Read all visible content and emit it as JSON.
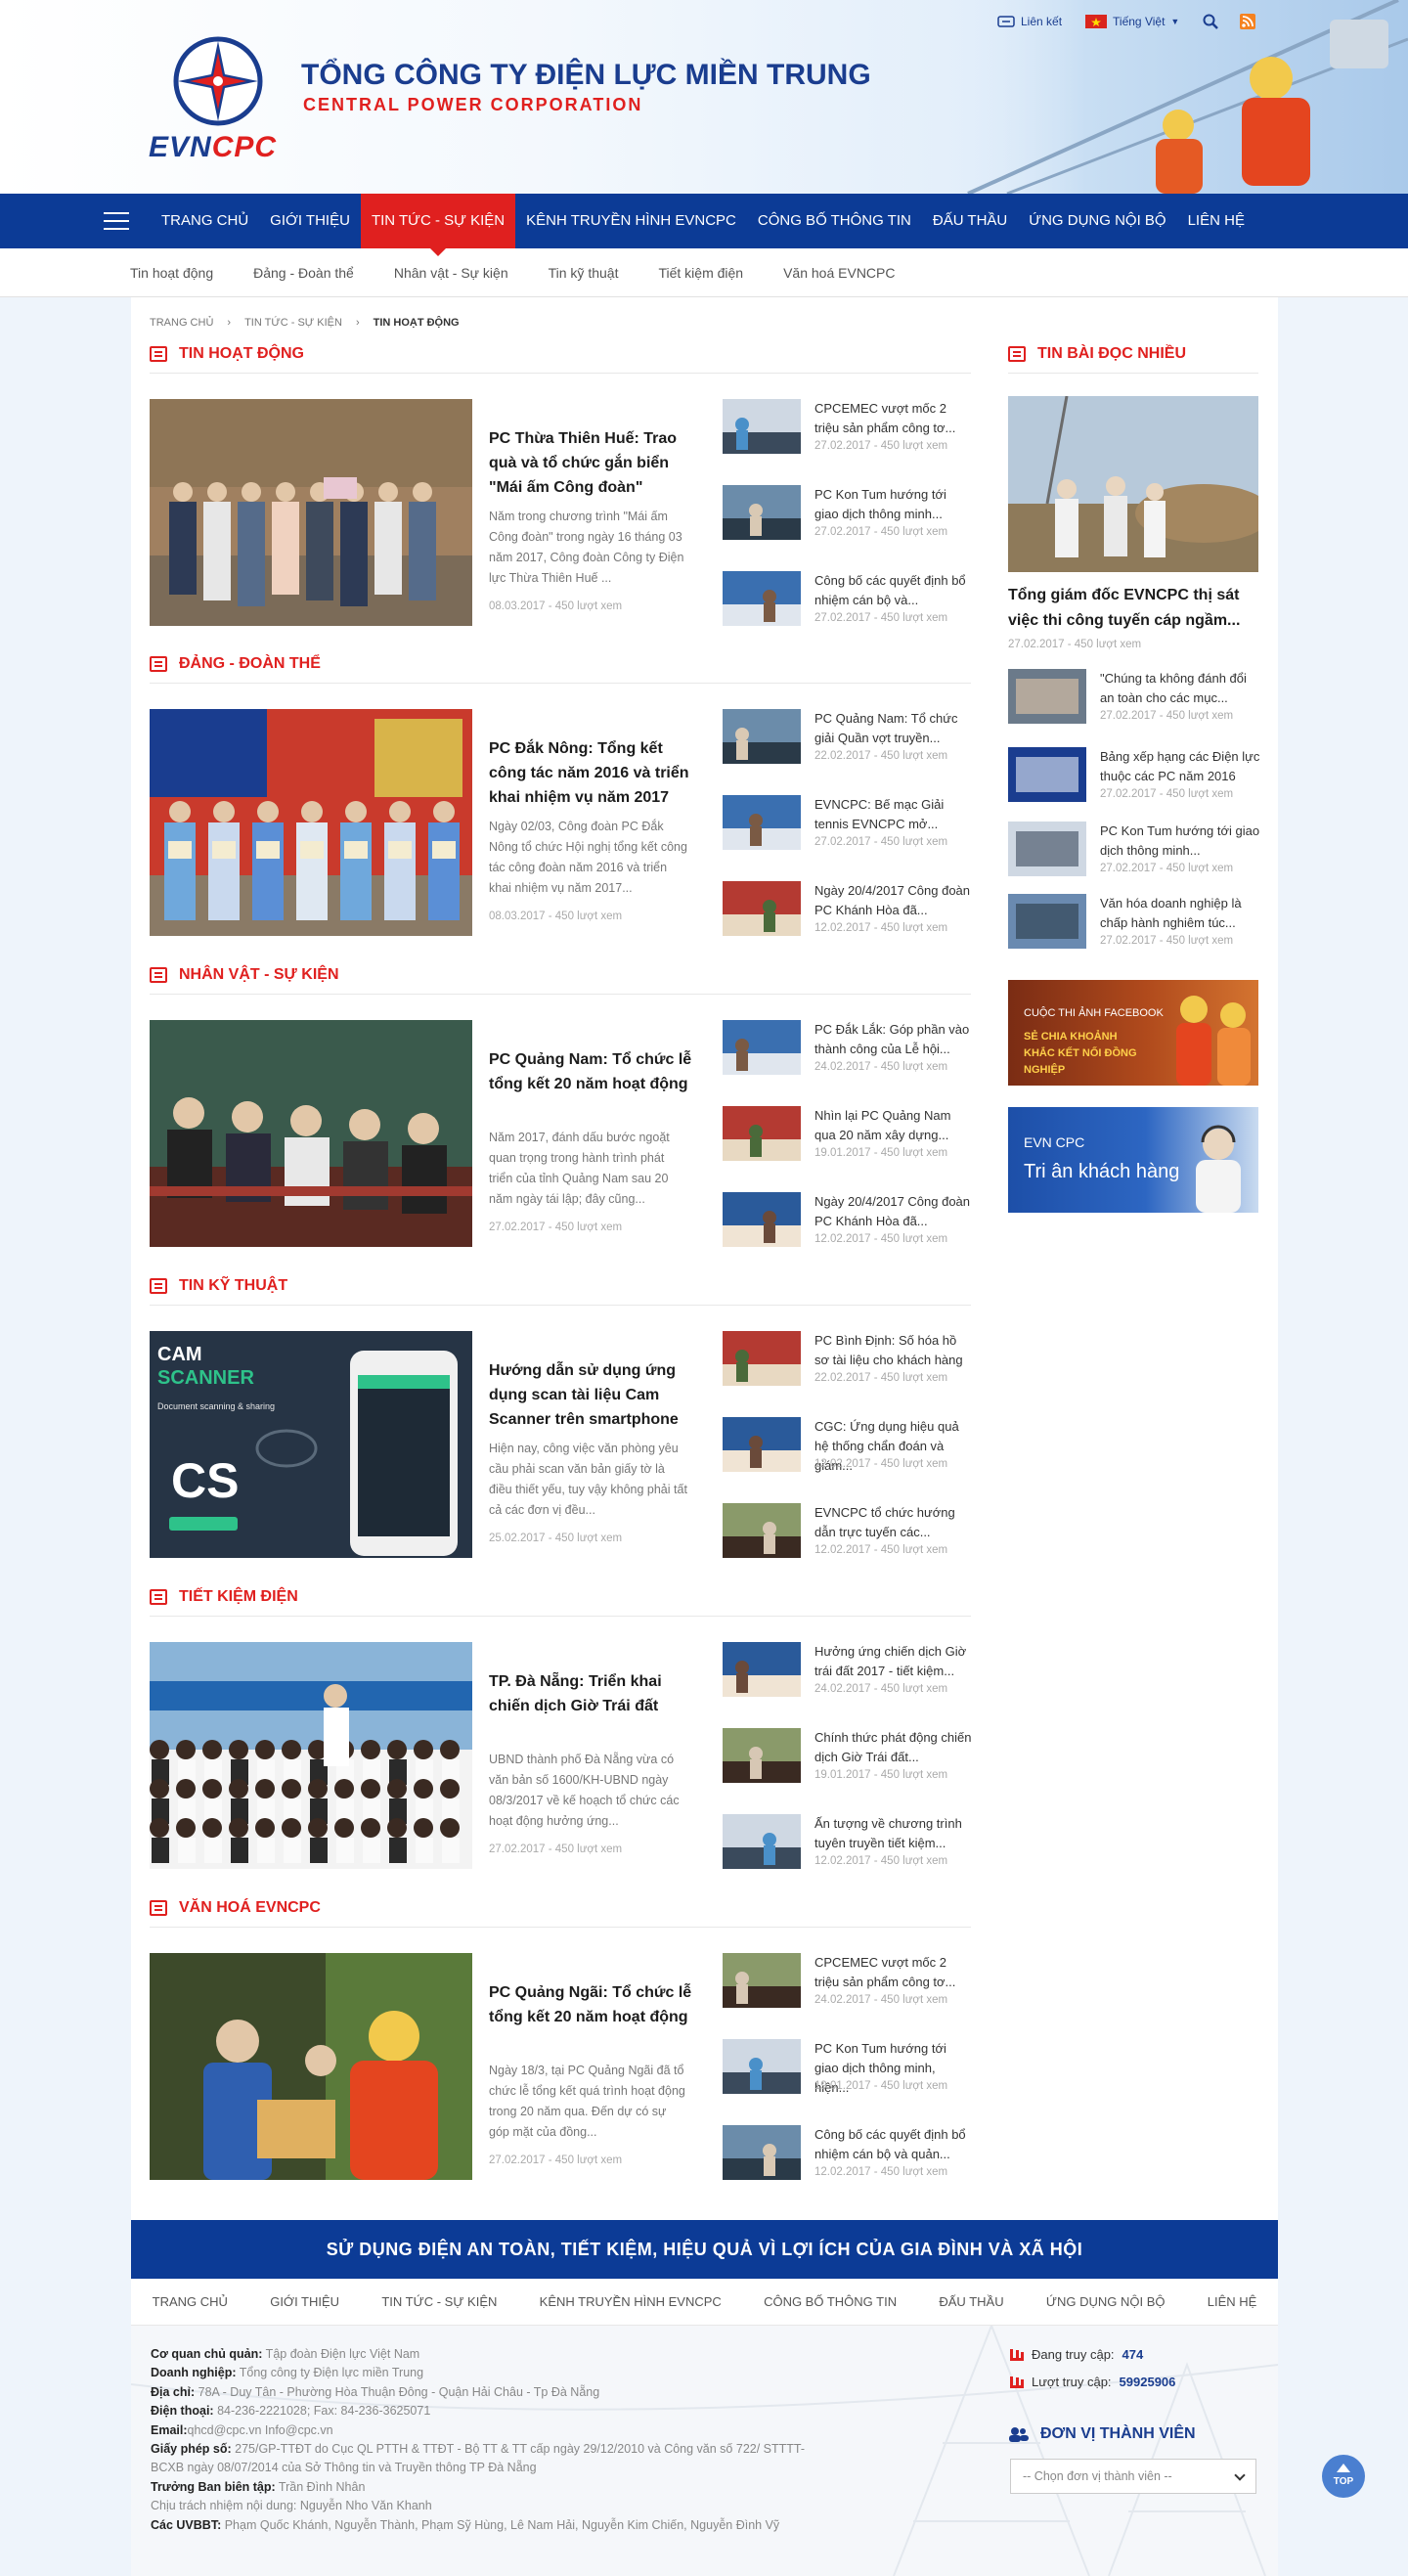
{
  "header": {
    "logo_text_evn": "EVN",
    "logo_text_cpc": "CPC",
    "company_name": "TỔNG CÔNG TY ĐIỆN LỰC MIỀN TRUNG",
    "company_sub": "CENTRAL POWER CORPORATION",
    "top_links": {
      "links_label": "Liên kết",
      "language_label": "Tiếng Việt"
    }
  },
  "nav": {
    "items": [
      "TRANG CHỦ",
      "GIỚI THIỆU",
      "TIN TỨC - SỰ KIỆN",
      "KÊNH TRUYỀN HÌNH EVNCPC",
      "CÔNG BỐ THÔNG TIN",
      "ĐẤU THẦU",
      "ỨNG DỤNG NỘI BỘ",
      "LIÊN HỆ"
    ],
    "active_index": 2
  },
  "subnav": [
    "Tin hoạt động",
    "Đảng - Đoàn thể",
    "Nhân vật - Sự kiện",
    "Tin kỹ thuật",
    "Tiết kiệm điện",
    "Văn hoá EVNCPC"
  ],
  "breadcrumb": [
    "TRANG CHỦ",
    "TIN TỨC - SỰ KIỆN",
    "TIN HOẠT ĐỘNG"
  ],
  "sections": [
    {
      "title": "TIN HOẠT ĐỘNG",
      "featured": {
        "title": "PC Thừa Thiên Huế: Trao quà và tổ chức gắn biển \"Mái ấm Công đoàn\"",
        "desc": "Năm trong chương trình \"Mái ấm Công đoàn\" trong ngày 16 tháng 03 năm 2017, Công đoàn Công ty Điện lực Thừa Thiên Huế ...",
        "meta": "08.03.2017 - 450 lượt xem"
      },
      "items": [
        {
          "title": "CPCEMEC vượt mốc 2 triệu sản phẩm công tơ...",
          "meta": "27.02.2017 - 450 lượt xem"
        },
        {
          "title": "PC Kon Tum hướng tới giao dịch thông minh...",
          "meta": "27.02.2017 - 450 lượt xem"
        },
        {
          "title": "Công bố các quyết định bổ nhiệm cán bộ và...",
          "meta": "27.02.2017 - 450 lượt xem"
        }
      ]
    },
    {
      "title": "ĐẢNG - ĐOÀN THỂ",
      "featured": {
        "title": "PC Đắk Nông: Tổng kết công tác năm 2016 và triển khai nhiệm vụ năm 2017",
        "desc": "Ngày 02/03, Công đoàn PC Đắk Nông tổ chức Hội nghị tổng kết công tác công đoàn năm 2016 và triển khai nhiệm vụ năm 2017...",
        "meta": "08.03.2017 - 450 lượt xem"
      },
      "items": [
        {
          "title": "PC Quảng Nam: Tổ chức giải Quần vợt truyền...",
          "meta": "22.02.2017 - 450 lượt xem"
        },
        {
          "title": "EVNCPC: Bế mạc Giải tennis EVNCPC mở...",
          "meta": "27.02.2017 - 450 lượt xem"
        },
        {
          "title": "Ngày 20/4/2017 Công đoàn PC Khánh Hòa đã...",
          "meta": "12.02.2017 - 450 lượt xem"
        }
      ]
    },
    {
      "title": "NHÂN VẬT - SỰ KIỆN",
      "featured": {
        "title": "PC Quảng Nam: Tổ chức lễ tổng kết 20 năm hoạt động",
        "desc": "Năm 2017, đánh dấu bước ngoặt quan trọng trong hành trình phát triển của tỉnh Quảng Nam sau 20 năm ngày tái lập; đây cũng...",
        "meta": "27.02.2017 - 450 lượt xem"
      },
      "items": [
        {
          "title": "PC Đắk Lắk: Góp phần vào thành công của Lễ hội...",
          "meta": "24.02.2017 - 450 lượt xem"
        },
        {
          "title": "Nhìn lại PC Quảng Nam qua 20 năm xây dựng...",
          "meta": "19.01.2017 - 450 lượt xem"
        },
        {
          "title": "Ngày 20/4/2017 Công đoàn PC Khánh Hòa đã...",
          "meta": "12.02.2017 - 450 lượt xem"
        }
      ]
    },
    {
      "title": "TIN KỸ THUẬT",
      "featured": {
        "title": "Hướng dẫn sử dụng ứng dụng scan tài liệu Cam Scanner trên smartphone",
        "desc": "Hiện nay, công việc văn phòng yêu cầu phải scan văn bản giấy tờ là điều thiết yếu, tuy vậy không phải tất cả các đơn vị đều...",
        "meta": "25.02.2017 - 450 lượt xem"
      },
      "items": [
        {
          "title": "PC Bình Định: Số hóa hồ sơ tài liệu cho khách hàng",
          "meta": "22.02.2017 - 450 lượt xem"
        },
        {
          "title": "CGC: Ứng dụng hiệu quả hệ thống chẩn đoán và giám...",
          "meta": "12.02.2017 - 450 lượt xem"
        },
        {
          "title": "EVNCPC tổ chức hướng dẫn trực tuyến các...",
          "meta": "12.02.2017 - 450 lượt xem"
        }
      ]
    },
    {
      "title": "TIẾT KIỆM ĐIỆN",
      "featured": {
        "title": "TP. Đà Nẵng: Triển khai chiến dịch Giờ Trái đất",
        "desc": "UBND thành phố Đà Nẵng vừa có văn bản số 1600/KH-UBND ngày 08/3/2017 về kế hoạch tổ chức các hoạt động hưởng ứng...",
        "meta": "27.02.2017 - 450 lượt xem"
      },
      "items": [
        {
          "title": "Hưởng ứng chiến dịch Giờ trái đất 2017 - tiết kiệm...",
          "meta": "24.02.2017 - 450 lượt xem"
        },
        {
          "title": "Chính thức phát động chiến dịch Giờ Trái đất...",
          "meta": "19.01.2017 - 450 lượt xem"
        },
        {
          "title": "Ấn tượng về chương trình tuyên truyền tiết kiệm...",
          "meta": "12.02.2017 - 450 lượt xem"
        }
      ]
    },
    {
      "title": "VĂN HOÁ EVNCPC",
      "featured": {
        "title": "PC Quảng Ngãi: Tổ chức lễ tổng kết 20 năm hoạt động",
        "desc": "Ngày 18/3, tại PC Quảng Ngãi đã tổ chức lễ tổng kết quá trình hoạt động trong 20 năm qua. Đến dự có sự góp mặt của đồng...",
        "meta": "27.02.2017 - 450 lượt xem"
      },
      "items": [
        {
          "title": "CPCEMEC vượt mốc 2 triệu sản phẩm công tơ...",
          "meta": "24.02.2017 - 450 lượt xem"
        },
        {
          "title": "PC Kon Tum hướng tới giao dịch thông minh, hiện...",
          "meta": "19.01.2017 - 450 lượt xem"
        },
        {
          "title": "Công bố các quyết định bổ nhiệm cán bộ và quản...",
          "meta": "12.02.2017 - 450 lượt xem"
        }
      ]
    }
  ],
  "right": {
    "title": "TIN BÀI ĐỌC NHIỀU",
    "featured": {
      "title": "Tổng giám đốc EVNCPC thị sát việc thi công tuyến cáp ngầm...",
      "meta": "27.02.2017 - 450 lượt xem"
    },
    "items": [
      {
        "title": "\"Chúng ta không đánh đổi an toàn cho các mục...",
        "meta": "27.02.2017 - 450 lượt xem"
      },
      {
        "title": "Bảng xếp hạng các Điện lực thuộc các PC năm 2016",
        "meta": "27.02.2017 - 450 lượt xem"
      },
      {
        "title": "PC Kon Tum hướng tới giao dịch thông minh...",
        "meta": "27.02.2017 - 450 lượt xem"
      },
      {
        "title": "Văn hóa doanh nghiệp là chấp hành nghiêm túc...",
        "meta": "27.02.2017 - 450 lượt xem"
      }
    ],
    "banner1": {
      "line1": "CUỘC THI ẢNH FACEBOOK",
      "line2": "SẺ CHIA KHOẢNH KHẮC KẾT NỐI ĐỒNG NGHIỆP"
    },
    "banner2": {
      "line1": "EVN CPC",
      "line2": "Tri ân khách hàng"
    }
  },
  "footer": {
    "slogan": "SỬ DỤNG ĐIỆN AN TOÀN, TIẾT KIỆM, HIỆU QUẢ VÌ LỢI ÍCH CỦA GIA ĐÌNH VÀ XÃ HỘI",
    "nav": [
      "TRANG CHỦ",
      "GIỚI THIỆU",
      "TIN TỨC - SỰ KIỆN",
      "KÊNH TRUYỀN HÌNH EVNCPC",
      "CÔNG BỐ THÔNG TIN",
      "ĐẤU THẦU",
      "ỨNG DỤNG NỘI BỘ",
      "LIÊN HỆ"
    ],
    "info": [
      {
        "label": "Cơ quan chủ quản:",
        "value": " Tập đoàn Điện lực Việt Nam"
      },
      {
        "label": "Doanh nghiệp:",
        "value": " Tổng công ty Điện lực miền Trung"
      },
      {
        "label": "Địa chỉ:",
        "value": " 78A - Duy Tân - Phường Hòa Thuận Đông - Quận Hải Châu - Tp Đà Nẵng"
      },
      {
        "label": "Điện thoại:",
        "value": " 84-236-2221028; Fax: 84-236-3625071"
      },
      {
        "label": "Email:",
        "value": "qhcd@cpc.vn   Info@cpc.vn"
      },
      {
        "label": "Giấy phép số:",
        "value": " 275/GP-TTĐT do Cục QL PTTH & TTĐT - Bộ TT & TT cấp ngày 29/12/2010 và Công văn số 722/ STTTT-BCXB ngày 08/07/2014 của Sở Thông tin và Truyền thông TP Đà Nẵng"
      },
      {
        "label": "Trưởng Ban biên tập:",
        "value": " Trần Đình Nhân"
      },
      {
        "label": "",
        "value": "Chịu trách nhiệm nội dung: Nguyễn Nho Văn Khanh"
      },
      {
        "label": "Các UVBBT:",
        "value": " Phạm Quốc Khánh, Nguyễn Thành, Phạm Sỹ Hùng, Lê Nam Hải, Nguyễn Kim Chiến, Nguyễn Đình Vỹ"
      }
    ],
    "stats": {
      "today_label": "Đang truy cập:",
      "today_value": "474",
      "total_label": "Lượt truy cập:",
      "total_value": "59925906"
    },
    "member_title": "ĐƠN VỊ THÀNH VIÊN",
    "member_placeholder": "-- Chọn đơn vị thành viên --",
    "top_label": "TOP"
  }
}
